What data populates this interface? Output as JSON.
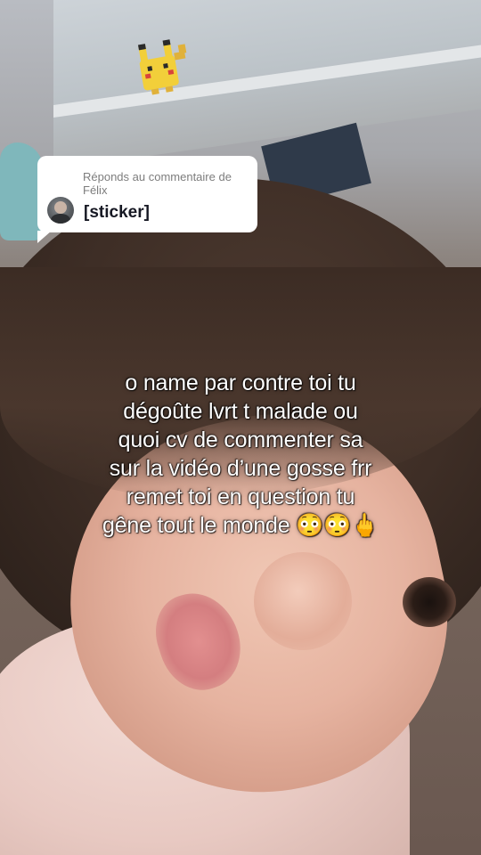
{
  "reply": {
    "header": "Réponds au commentaire de Félix",
    "body": "[sticker]"
  },
  "caption": {
    "lines": [
      "o name par contre toi tu",
      "dégoûte lvrt t malade ou",
      "quoi cv de commenter sa",
      "sur la vidéo d’une gosse frr",
      "remet toi en question tu",
      "gêne tout le monde 😳😳🖕"
    ]
  },
  "icons": {
    "avatar": "profile-avatar-icon",
    "background_sticker": "pikachu-icon"
  },
  "colors": {
    "bubble_background": "#ffffff",
    "bubble_header_text": "#7d7d7d",
    "bubble_body_text": "#161823",
    "caption_text": "#ffffff"
  }
}
